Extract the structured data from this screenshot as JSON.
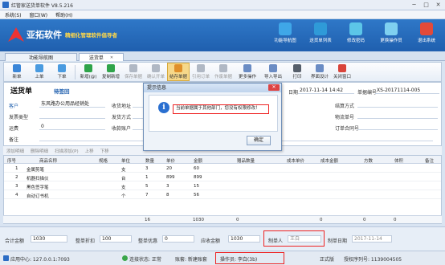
{
  "window": {
    "title": "红管家送货单软件 V8.5.216",
    "min": "─",
    "max": "□",
    "close": "✕"
  },
  "menu": [
    "系统(S)",
    "窗口(W)",
    "帮助(H)"
  ],
  "banner": {
    "brand": "亚拓软件",
    "slogan": "精细化管理软件倡导者",
    "quick": [
      {
        "label": "功能导航图",
        "color": "#3fa7e8"
      },
      {
        "label": "送货单列表",
        "color": "#2f9ad8"
      },
      {
        "label": "修改密码",
        "color": "#5cc6e8"
      },
      {
        "label": "更换操作员",
        "color": "#7fd0f0"
      },
      {
        "label": "退出系统",
        "color": "#e24a3a"
      }
    ]
  },
  "tabs": [
    {
      "label": "功能导航图"
    },
    {
      "label": "送货单",
      "close": "✕"
    }
  ],
  "toolbar": [
    {
      "label": "新单",
      "color": "#3a86d8"
    },
    {
      "label": "上单",
      "color": "#4a9be0"
    },
    {
      "label": "下单",
      "color": "#4a9be0"
    },
    {
      "label": "新增(@)",
      "color": "#2fa44a"
    },
    {
      "label": "复制新增",
      "color": "#2fa44a"
    },
    {
      "label": "保存单据",
      "color": "#b0b8c4",
      "disabled": true
    },
    {
      "label": "确认开单",
      "color": "#b0b8c4",
      "disabled": true
    },
    {
      "label": "结存单据",
      "color": "#e0902a",
      "active": true
    },
    {
      "label": "引用订单",
      "color": "#b0b8c4",
      "disabled": true
    },
    {
      "label": "作废单据",
      "color": "#b0b8c4",
      "disabled": true
    },
    {
      "label": "更多操作",
      "color": "#6a8cc4"
    },
    {
      "label": "导入导出",
      "color": "#6a8cc4"
    },
    {
      "label": "打印",
      "color": "#555e6a"
    },
    {
      "label": "界面设计",
      "color": "#6a8cc4"
    },
    {
      "label": "关闭窗口",
      "color": "#d9443a"
    }
  ],
  "form": {
    "title": "送货单",
    "status": "待签回",
    "date_label": "日期",
    "date": "2017-11-14 14:42",
    "no_label": "单据编号",
    "no": "XS-20171114-005",
    "customer_label": "客户",
    "customer": "东风路办公用品经销处",
    "invoice_label": "发票类型",
    "invoice": "",
    "freight_label": "运费",
    "freight": "0",
    "note_label": "备注",
    "note": "",
    "addr_label": "收货地址",
    "ship_label": "发货方式",
    "contact_label": "联系电话",
    "receiver_label": "收款账户",
    "settle_label": "结算方式",
    "logistics_label": "物流单号",
    "order_label": "订单合同号"
  },
  "actions": [
    "添加明细",
    "删除明细",
    "扫描添加(P)",
    "上移",
    "下移"
  ],
  "grid": {
    "headers": [
      "序号",
      "商品名称",
      "规格",
      "单位",
      "数量",
      "单价",
      "金额",
      "赠品数量",
      "成本单价",
      "成本金额",
      "方数",
      "体积",
      "备注"
    ],
    "rows": [
      [
        "1",
        "金属剪笔",
        "",
        "支",
        "3",
        "20",
        "60"
      ],
      [
        "2",
        "机器扫描仪",
        "",
        "台",
        "1",
        "899",
        "899"
      ],
      [
        "3",
        "黑色签字笔",
        "",
        "支",
        "5",
        "3",
        "15"
      ],
      [
        "4",
        "自动订书机",
        "",
        "个",
        "7",
        "8",
        "56"
      ]
    ],
    "total_qty": "16",
    "total_amount": "1030",
    "total_gift": "0",
    "total_cost": "0",
    "total_square": "0",
    "total_volume": "0"
  },
  "footer": {
    "total_label": "合计金额",
    "total": "1030",
    "discount_label": "整单折扣",
    "discount": "100",
    "preferential_label": "整单优惠",
    "preferential": "0",
    "receivable_label": "应收金额",
    "receivable": "1030",
    "maker_label": "制单人",
    "maker": "王白",
    "make_date_label": "制单日期",
    "make_date": "2017-11-14"
  },
  "status": {
    "center": "应用中心: 127.0.0.1:7093",
    "connection": "连接状态: 正常",
    "account": "账套: 新建账套",
    "operator": "操作员: 李白(3b)",
    "edition": "正式版",
    "serial": "授权序列号: 1139004505"
  },
  "dialog": {
    "title": "提示信息",
    "close": "✕",
    "icon": "i",
    "message": "当前单据属于其他部门，您没有权限修改！",
    "ok": "确定"
  }
}
